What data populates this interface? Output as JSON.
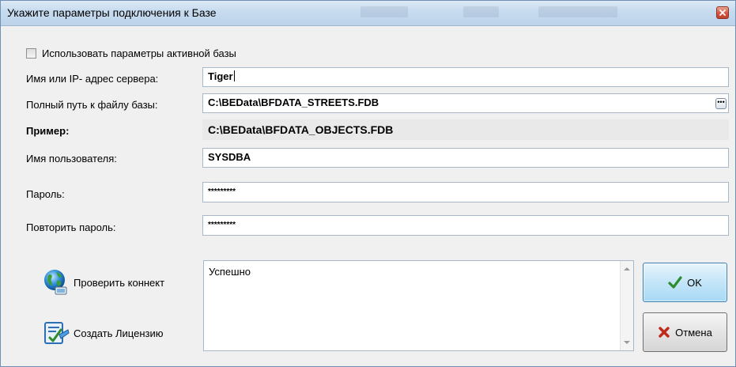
{
  "window": {
    "title": "Укажите параметры подключения к Базе"
  },
  "form": {
    "use_active_label": "Использовать параметры активной базы",
    "use_active_checked": false,
    "server_label": "Имя или IP- адрес сервера:",
    "server_value": "Tiger",
    "path_label": "Полный путь к файлу базы:",
    "path_value": "C:\\BEData\\BFDATA_STREETS.FDB",
    "example_label": "Пример:",
    "example_value": "C:\\BEData\\BFDATA_OBJECTS.FDB",
    "user_label": "Имя пользователя:",
    "user_value": "SYSDBA",
    "password_label": "Пароль:",
    "password_value": "*********",
    "repeat_label": "Повторить пароль:",
    "repeat_value": "*********"
  },
  "actions": {
    "check_label": "Проверить коннект",
    "license_label": "Создать Лицензию"
  },
  "status": {
    "text": "Успешно"
  },
  "buttons": {
    "ok_label": "OK",
    "cancel_label": "Отмена"
  },
  "colors": {
    "ok_check": "#2e8b2e",
    "cancel_x": "#c0281c",
    "titlebar": "#c8dcef"
  },
  "icons": {
    "ellipsis": "ellipsis-icon",
    "globe": "globe-network-icon",
    "license": "license-document-icon",
    "check": "checkmark-icon",
    "cross": "cross-icon",
    "close": "close-icon"
  }
}
